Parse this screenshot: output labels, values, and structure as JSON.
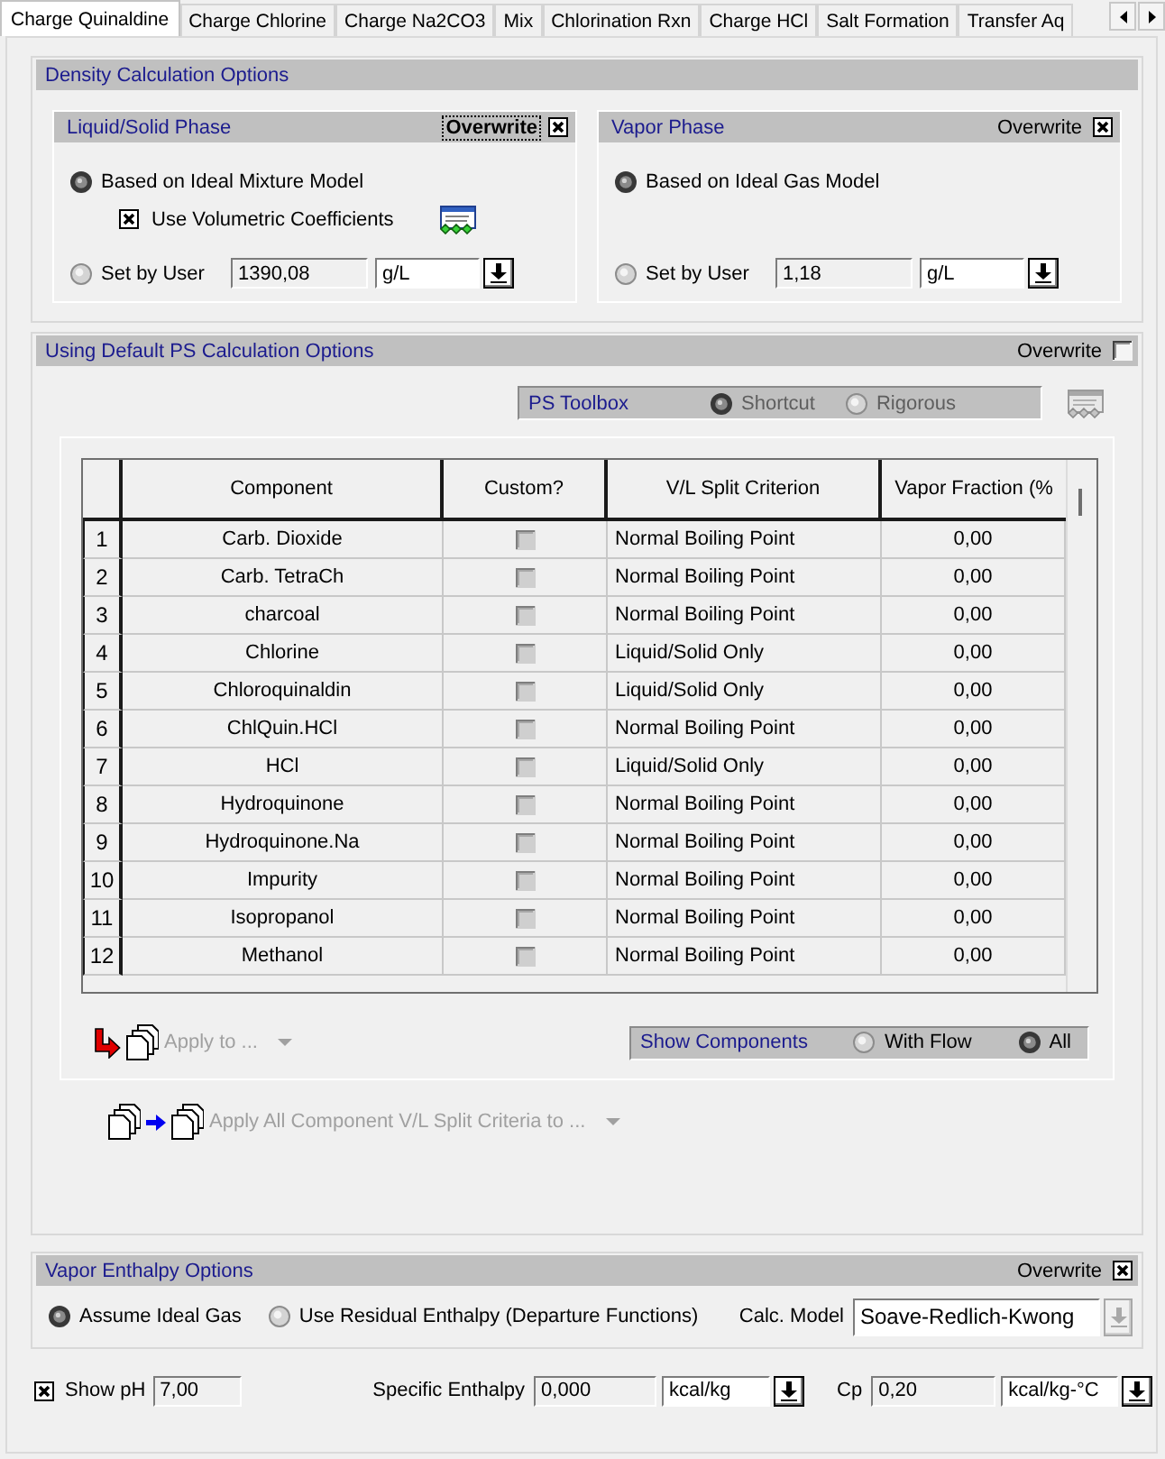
{
  "tabs": [
    {
      "label": "Charge Quinaldine",
      "selected": true
    },
    {
      "label": "Charge Chlorine",
      "selected": false
    },
    {
      "label": "Charge Na2CO3",
      "selected": false
    },
    {
      "label": "Mix",
      "selected": false
    },
    {
      "label": "Chlorination Rxn",
      "selected": false
    },
    {
      "label": "Charge HCl",
      "selected": false
    },
    {
      "label": "Salt Formation",
      "selected": false
    },
    {
      "label": "Transfer Aq",
      "selected": false
    }
  ],
  "density": {
    "title": "Density Calculation Options",
    "phases": [
      {
        "title": "Liquid/Solid Phase",
        "overwrite": {
          "label": "Overwrite",
          "checked": true,
          "focused": true
        },
        "model": {
          "label": "Based on Ideal Mixture Model",
          "selected": true
        },
        "coefficients": {
          "label": "Use Volumetric Coefficients",
          "checked": true
        },
        "user": {
          "label": "Set by User",
          "selected": false,
          "value": "1390,08",
          "unit": "g/L"
        }
      },
      {
        "title": "Vapor Phase",
        "overwrite": {
          "label": "Overwrite",
          "checked": true,
          "focused": false
        },
        "model": {
          "label": "Based on Ideal Gas Model",
          "selected": true
        },
        "user": {
          "label": "Set by User",
          "selected": false,
          "value": "1,18",
          "unit": "g/L"
        }
      }
    ]
  },
  "ps": {
    "title": "Using Default PS Calculation Options",
    "overwrite": {
      "label": "Overwrite",
      "checked": false
    },
    "toolbox": {
      "label": "PS Toolbox",
      "options": [
        {
          "label": "Shortcut",
          "selected": true,
          "disabled": true
        },
        {
          "label": "Rigorous",
          "selected": false,
          "disabled": true
        }
      ]
    },
    "table": {
      "columns": [
        "Component",
        "Custom?",
        "V/L Split Criterion",
        "Vapor Fraction (%"
      ],
      "rows": [
        {
          "number": "1",
          "component": "Carb. Dioxide",
          "custom": false,
          "criterion": "Normal Boiling Point",
          "vapor_fraction": "0,00"
        },
        {
          "number": "2",
          "component": "Carb. TetraCh",
          "custom": false,
          "criterion": "Normal Boiling Point",
          "vapor_fraction": "0,00"
        },
        {
          "number": "3",
          "component": "charcoal",
          "custom": false,
          "criterion": "Normal Boiling Point",
          "vapor_fraction": "0,00"
        },
        {
          "number": "4",
          "component": "Chlorine",
          "custom": false,
          "criterion": "Liquid/Solid Only",
          "vapor_fraction": "0,00"
        },
        {
          "number": "5",
          "component": "Chloroquinaldin",
          "custom": false,
          "criterion": "Liquid/Solid Only",
          "vapor_fraction": "0,00"
        },
        {
          "number": "6",
          "component": "ChlQuin.HCl",
          "custom": false,
          "criterion": "Normal Boiling Point",
          "vapor_fraction": "0,00"
        },
        {
          "number": "7",
          "component": "HCl",
          "custom": false,
          "criterion": "Liquid/Solid Only",
          "vapor_fraction": "0,00"
        },
        {
          "number": "8",
          "component": "Hydroquinone",
          "custom": false,
          "criterion": "Normal Boiling Point",
          "vapor_fraction": "0,00"
        },
        {
          "number": "9",
          "component": "Hydroquinone.Na",
          "custom": false,
          "criterion": "Normal Boiling Point",
          "vapor_fraction": "0,00"
        },
        {
          "number": "10",
          "component": "Impurity",
          "custom": false,
          "criterion": "Normal Boiling Point",
          "vapor_fraction": "0,00"
        },
        {
          "number": "11",
          "component": "Isopropanol",
          "custom": false,
          "criterion": "Normal Boiling Point",
          "vapor_fraction": "0,00"
        },
        {
          "number": "12",
          "component": "Methanol",
          "custom": false,
          "criterion": "Normal Boiling Point",
          "vapor_fraction": "0,00"
        }
      ]
    },
    "apply": {
      "label": "Apply to ...",
      "disabled": true
    },
    "show_components": {
      "label": "Show Components",
      "options": [
        {
          "label": "With Flow",
          "selected": false
        },
        {
          "label": "All",
          "selected": true
        }
      ]
    },
    "apply_all": {
      "label": "Apply All Component V/L Split Criteria to ...",
      "disabled": true
    }
  },
  "vapor_enthalpy": {
    "title": "Vapor Enthalpy Options",
    "overwrite": {
      "label": "Overwrite",
      "checked": true
    },
    "options": [
      {
        "label": "Assume Ideal Gas",
        "selected": true
      },
      {
        "label": "Use Residual Enthalpy (Departure Functions)",
        "selected": false
      }
    ],
    "calc_model": {
      "label": "Calc. Model",
      "value": "Soave-Redlich-Kwong",
      "disabled": true
    }
  },
  "properties": {
    "show_ph": {
      "label": "Show pH",
      "checked": true,
      "value": "7,00"
    },
    "fields": [
      {
        "label": "Specific Enthalpy",
        "value": "0,000",
        "unit": "kcal/kg"
      },
      {
        "label": "Cp",
        "value": "0,20",
        "unit": "kcal/kg-°C"
      }
    ]
  }
}
